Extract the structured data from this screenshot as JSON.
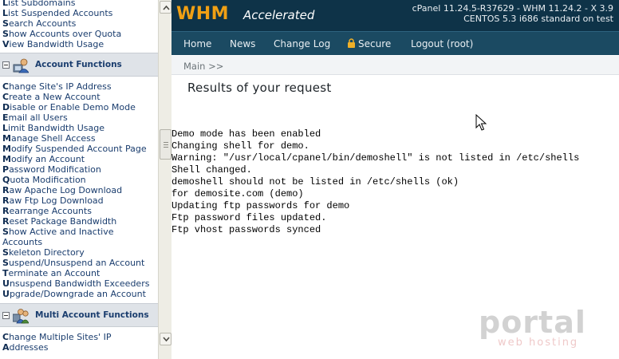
{
  "sidebar": {
    "top_links": [
      {
        "first": "L",
        "rest": "ist Subdomains"
      },
      {
        "first": "L",
        "rest": "ist Suspended Accounts"
      },
      {
        "first": "S",
        "rest": "earch Accounts"
      },
      {
        "first": "S",
        "rest": "how Accounts over Quota"
      },
      {
        "first": "V",
        "rest": "iew Bandwidth Usage"
      }
    ],
    "account_functions": {
      "title": "Account Functions",
      "items": [
        {
          "first": "C",
          "rest": "hange Site's IP Address"
        },
        {
          "first": "C",
          "rest": "reate a New Account"
        },
        {
          "first": "D",
          "rest": "isable or Enable Demo Mode"
        },
        {
          "first": "E",
          "rest": "mail all Users"
        },
        {
          "first": "L",
          "rest": "imit Bandwidth Usage"
        },
        {
          "first": "M",
          "rest": "anage Shell Access"
        },
        {
          "first": "M",
          "rest": "odify Suspended Account Page"
        },
        {
          "first": "M",
          "rest": "odify an Account"
        },
        {
          "first": "P",
          "rest": "assword Modification"
        },
        {
          "first": "Q",
          "rest": "uota Modification"
        },
        {
          "first": "R",
          "rest": "aw Apache Log Download"
        },
        {
          "first": "R",
          "rest": "aw Ftp Log Download"
        },
        {
          "first": "R",
          "rest": "earrange Accounts"
        },
        {
          "first": "R",
          "rest": "eset Package Bandwidth"
        },
        {
          "first": "S",
          "rest": "how Active and Inactive Accounts"
        },
        {
          "first": "S",
          "rest": "keleton Directory"
        },
        {
          "first": "S",
          "rest": "uspend/Unsuspend an Account"
        },
        {
          "first": "T",
          "rest": "erminate an Account"
        },
        {
          "first": "U",
          "rest": "nsuspend Bandwidth Exceeders"
        },
        {
          "first": "U",
          "rest": "pgrade/Downgrade an Account"
        }
      ]
    },
    "multi_account_functions": {
      "title": "Multi Account Functions",
      "items": [
        {
          "first": "C",
          "rest": "hange Multiple Sites' IP"
        },
        {
          "first": "A",
          "rest": "ddresses"
        }
      ]
    }
  },
  "header": {
    "logo_whm": "WHM",
    "logo_accelerated": "Accelerated",
    "version_line1": "cPanel 11.24.5-R37629 - WHM 11.24.2 - X 3.9",
    "version_line2": "CENTOS 5.3 i686 standard on test"
  },
  "nav": {
    "home": "Home",
    "news": "News",
    "change_log": "Change Log",
    "secure": "Secure",
    "logout": "Logout (root)"
  },
  "breadcrumb": "Main >>",
  "page_title": "Results of your request",
  "output_lines": [
    "Demo mode has been enabled",
    "Changing shell for demo.",
    "Warning: \"/usr/local/cpanel/bin/demoshell\" is not listed in /etc/shells",
    "Shell changed.",
    "demoshell should not be listed in /etc/shells (ok)",
    "for demosite.com (demo)",
    "Updating ftp passwords for demo",
    "Ftp password files updated.",
    "Ftp vhost passwords synced"
  ],
  "watermark": {
    "brand": "portal",
    "sub": "web hosting"
  },
  "colors": {
    "banner": "#0e3348",
    "nav": "#1b4a62",
    "logo_accent": "#f0a014",
    "link": "#1a3d6e"
  }
}
